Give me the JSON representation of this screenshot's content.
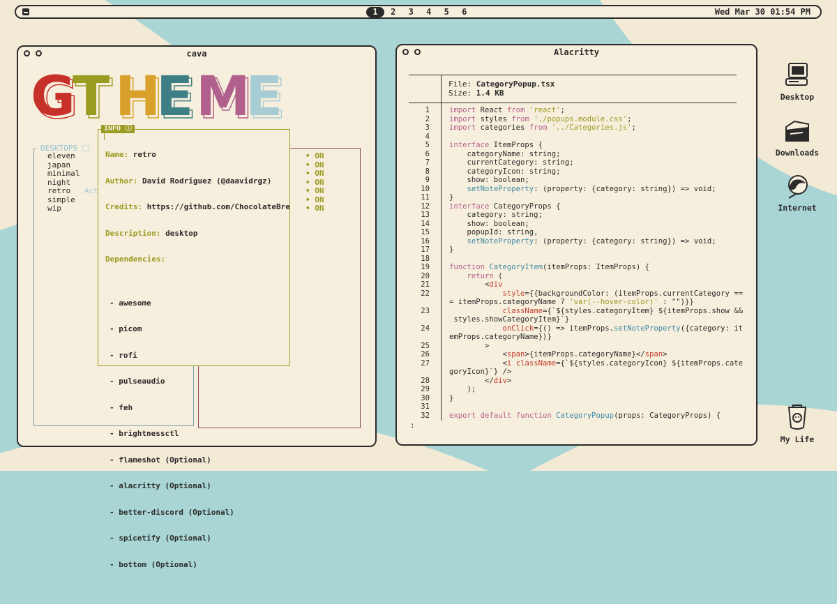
{
  "topbar": {
    "workspaces": [
      "1",
      "2",
      "3",
      "4",
      "5",
      "6"
    ],
    "active_workspace": "1",
    "clock": "Wed Mar 30  01:54 PM"
  },
  "cava_window": {
    "title": "cava",
    "logo_letters": [
      "G",
      "T",
      "H",
      "E",
      "M",
      "E"
    ],
    "logo_colors": [
      "#c8312a",
      "#9a9b23",
      "#d9a12b",
      "#3e7f85",
      "#b15f8c",
      "#a7ccd4"
    ],
    "desktops": {
      "header": "DESKTOPS",
      "items": [
        "eleven",
        "japan",
        "minimal",
        "night",
        "retro",
        "simple",
        "wip"
      ],
      "active_suffix": " · Act"
    },
    "status_values": [
      "• ON",
      "• ON",
      "• ON",
      "• ON",
      "• ON",
      "• ON",
      "• ON"
    ],
    "info": {
      "tag": "INFO ⓘ",
      "name_label": "Name:",
      "name": "retro",
      "author_label": "Author:",
      "author": "David Rodriguez (@daavidrgz)",
      "credits_label": "Credits:",
      "credits": "https://github.com/ChocolateBre",
      "description_label": "Description:",
      "description": "desktop",
      "dependencies_label": "Dependencies:",
      "dependencies": [
        "- awesome",
        "- picom",
        "- rofi",
        "- pulseaudio",
        "- feh",
        "- brightnessctl",
        "- flameshot (Optional)",
        "- alacritty (Optional)",
        "- better-discord (Optional)",
        "- spicetify (Optional)",
        "- bottom (Optional)"
      ]
    }
  },
  "alacritty_window": {
    "title": "Alacritty",
    "file_label": "File:",
    "file_name": "CategoryPopup.tsx",
    "size_label": "Size:",
    "size": "1.4 KB",
    "prompt": ":",
    "lines": [
      {
        "n": "1",
        "t": "import React from 'react';"
      },
      {
        "n": "2",
        "t": "import styles from './popups.module.css';"
      },
      {
        "n": "3",
        "t": "import categories from '../Categories.js';"
      },
      {
        "n": "4",
        "t": ""
      },
      {
        "n": "5",
        "t": "interface ItemProps {"
      },
      {
        "n": "6",
        "t": "    categoryName: string;"
      },
      {
        "n": "7",
        "t": "    currentCategory: string;"
      },
      {
        "n": "8",
        "t": "    categoryIcon: string;"
      },
      {
        "n": "9",
        "t": "    show: boolean;"
      },
      {
        "n": "10",
        "t": "    setNoteProperty: (property: {category: string}) => void;"
      },
      {
        "n": "11",
        "t": "}"
      },
      {
        "n": "12",
        "t": "interface CategoryProps {"
      },
      {
        "n": "13",
        "t": "    category: string;"
      },
      {
        "n": "14",
        "t": "    show: boolean;"
      },
      {
        "n": "15",
        "t": "    popupId: string,"
      },
      {
        "n": "16",
        "t": "    setNoteProperty: (property: {category: string}) => void;"
      },
      {
        "n": "17",
        "t": "}"
      },
      {
        "n": "18",
        "t": ""
      },
      {
        "n": "19",
        "t": "function CategoryItem(itemProps: ItemProps) {"
      },
      {
        "n": "20",
        "t": "    return ("
      },
      {
        "n": "21",
        "t": "        <div"
      },
      {
        "n": "22",
        "t": "            style={{backgroundColor: (itemProps.currentCategory =="
      },
      {
        "n": "",
        "t": "= itemProps.categoryName ? 'var(--hover-color)' : \"\")}}"
      },
      {
        "n": "23",
        "t": "            className={`${styles.categoryItem} ${itemProps.show &&"
      },
      {
        "n": "",
        "t": " styles.showCategoryItem}`}"
      },
      {
        "n": "24",
        "t": "            onClick={() => itemProps.setNoteProperty({category: it"
      },
      {
        "n": "",
        "t": "emProps.categoryName})}"
      },
      {
        "n": "25",
        "t": "        >"
      },
      {
        "n": "26",
        "t": "            <span>{itemProps.categoryName}</span>"
      },
      {
        "n": "27",
        "t": "            <i className={`${styles.categoryIcon} ${itemProps.cate"
      },
      {
        "n": "",
        "t": "goryIcon}`} />"
      },
      {
        "n": "28",
        "t": "        </div>"
      },
      {
        "n": "29",
        "t": "    );"
      },
      {
        "n": "30",
        "t": "}"
      },
      {
        "n": "31",
        "t": ""
      },
      {
        "n": "32",
        "t": "export default function CategoryPopup(props: CategoryProps) {"
      }
    ]
  },
  "desktop_icons": [
    {
      "label": "Desktop",
      "icon": "computer-icon"
    },
    {
      "label": "Downloads",
      "icon": "folder-icon"
    },
    {
      "label": "Internet",
      "icon": "globe-icon"
    },
    {
      "label": "My Life",
      "icon": "pocket-icon"
    }
  ],
  "colors": {
    "background": "#a9d5d4",
    "cream": "#f7efdd",
    "olive": "#9a9b23",
    "maroon": "#8c4a5b"
  }
}
